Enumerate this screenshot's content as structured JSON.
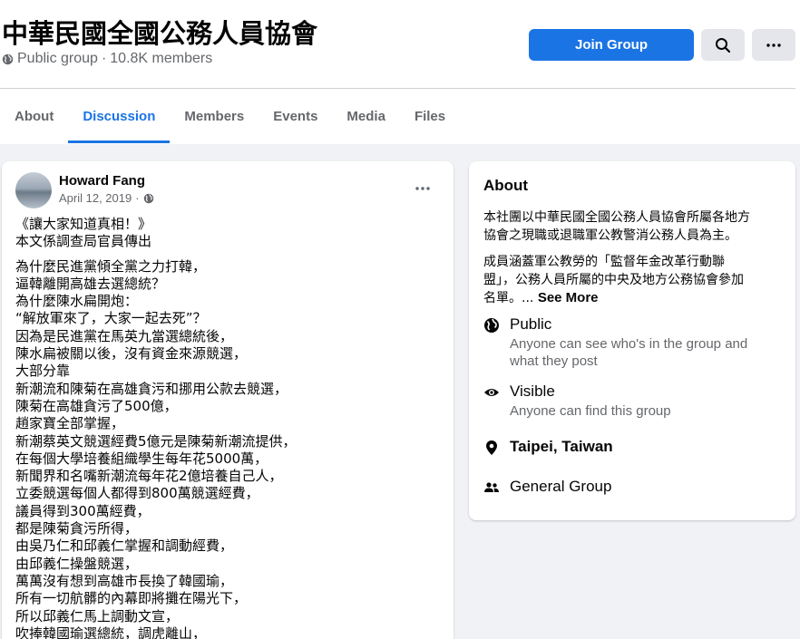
{
  "group": {
    "title": "中華民國全國公務人員協會",
    "privacy": "Public group",
    "separator": "·",
    "members": "10.8K members"
  },
  "actions": {
    "join_label": "Join Group",
    "search_icon": "search-icon",
    "more_icon": "more-icon"
  },
  "tabs": [
    {
      "label": "About"
    },
    {
      "label": "Discussion",
      "active": true
    },
    {
      "label": "Members"
    },
    {
      "label": "Events"
    },
    {
      "label": "Media"
    },
    {
      "label": "Files"
    }
  ],
  "post": {
    "author": "Howard Fang",
    "date": "April 12, 2019",
    "separator": "·",
    "intro": [
      "《讓大家知道真相！》",
      "本文係調查局官員傳出"
    ],
    "lines": [
      "為什麼民進黨傾全黨之力打韓，",
      "逼韓離開高雄去選總統？",
      "為什麼陳水扁開炮：",
      "“解放軍來了，大家一起去死”？",
      "因為是民進黨在馬英九當選總統後，",
      "陳水扁被關以後，沒有資金來源競選，",
      "大部分靠",
      "新潮流和陳菊在高雄貪污和挪用公款去競選，",
      "陳菊在高雄貪污了500億，",
      "趙家寶全部掌握，",
      "新潮蔡英文競選經費5億元是陳菊新潮流提供，",
      "在每個大學培養組織學生每年花5000萬，",
      "新聞界和名嘴新潮流每年花2億培養自己人，",
      "立委競選每個人都得到800萬競選經費，",
      "議員得到300萬經費，",
      "都是陳菊貪污所得，",
      "由吳乃仁和邱義仁掌握和調動經費，",
      "由邱義仁操盤競選，",
      "萬萬沒有想到高雄市長換了韓國瑜，",
      "所有一切航髒的內幕即將攤在陽光下，",
      "所以邱義仁馬上調動文宣，",
      "吹捧韓國瑜選總統，調虎離山，"
    ]
  },
  "about": {
    "title": "About",
    "desc_p1": [
      "本社團以中華民國全國公務人員協會所屬各地方",
      "協會之現職或退職軍公教警消公務人員為主。"
    ],
    "desc_p2": [
      "成員涵蓋軍公教勞的「監督年金改革行動聯",
      "盟」，公務人員所屬的中央及地方公務協會參加"
    ],
    "desc_p2_last": "名單。...",
    "see_more": "See More",
    "items": [
      {
        "icon": "globe-icon",
        "title": "Public",
        "sub": [
          "Anyone can see who's in the group and",
          "what they post"
        ]
      },
      {
        "icon": "eye-icon",
        "title": "Visible",
        "sub": [
          "Anyone can find this group"
        ]
      },
      {
        "icon": "location-pin-icon",
        "title": "Taipei, Taiwan",
        "sub": []
      },
      {
        "icon": "people-icon",
        "title": "General Group",
        "sub": []
      }
    ]
  },
  "colors": {
    "accent": "#1b74e4",
    "background": "#f0f2f5",
    "secondary_text": "#65676b"
  }
}
